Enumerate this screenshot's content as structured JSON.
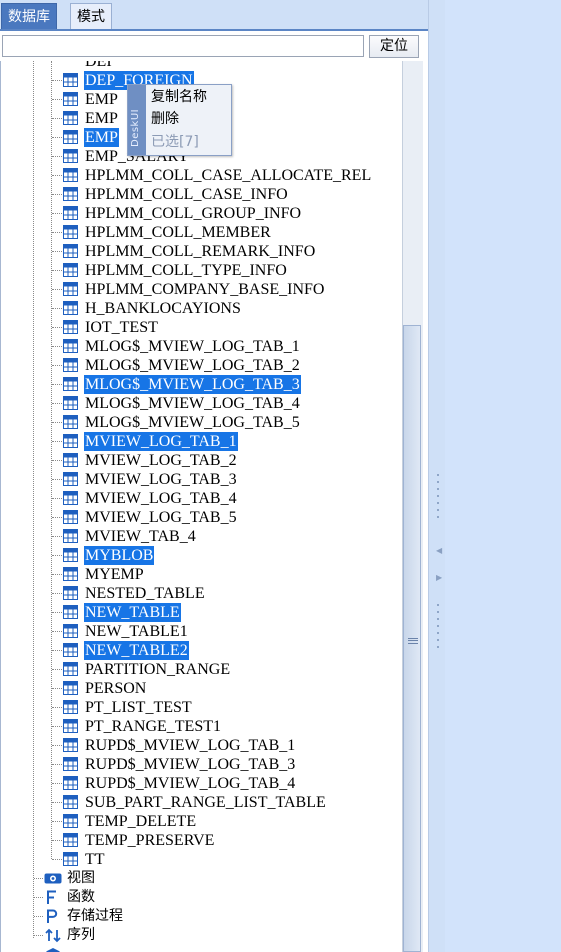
{
  "tabs": [
    {
      "label": "数据库",
      "active": true
    },
    {
      "label": "模式",
      "active": false
    }
  ],
  "search": {
    "value": "",
    "placeholder": "",
    "locate_label": "定位"
  },
  "tables": [
    {
      "name": "DEP_FOREIGN",
      "selected": true
    },
    {
      "name": "EMP",
      "selected": false
    },
    {
      "name": "EMP",
      "selected": false
    },
    {
      "name": "EMP",
      "selected": true
    },
    {
      "name": "EMP_SALARY",
      "selected": false
    },
    {
      "name": "HPLMM_COLL_CASE_ALLOCATE_REL",
      "selected": false
    },
    {
      "name": "HPLMM_COLL_CASE_INFO",
      "selected": false
    },
    {
      "name": "HPLMM_COLL_GROUP_INFO",
      "selected": false
    },
    {
      "name": "HPLMM_COLL_MEMBER",
      "selected": false
    },
    {
      "name": "HPLMM_COLL_REMARK_INFO",
      "selected": false
    },
    {
      "name": "HPLMM_COLL_TYPE_INFO",
      "selected": false
    },
    {
      "name": "HPLMM_COMPANY_BASE_INFO",
      "selected": false
    },
    {
      "name": "H_BANKLOCAYIONS",
      "selected": false
    },
    {
      "name": "IOT_TEST",
      "selected": false
    },
    {
      "name": "MLOG$_MVIEW_LOG_TAB_1",
      "selected": false
    },
    {
      "name": "MLOG$_MVIEW_LOG_TAB_2",
      "selected": false
    },
    {
      "name": "MLOG$_MVIEW_LOG_TAB_3",
      "selected": true
    },
    {
      "name": "MLOG$_MVIEW_LOG_TAB_4",
      "selected": false
    },
    {
      "name": "MLOG$_MVIEW_LOG_TAB_5",
      "selected": false
    },
    {
      "name": "MVIEW_LOG_TAB_1",
      "selected": true
    },
    {
      "name": "MVIEW_LOG_TAB_2",
      "selected": false
    },
    {
      "name": "MVIEW_LOG_TAB_3",
      "selected": false
    },
    {
      "name": "MVIEW_LOG_TAB_4",
      "selected": false
    },
    {
      "name": "MVIEW_LOG_TAB_5",
      "selected": false
    },
    {
      "name": "MVIEW_TAB_4",
      "selected": false
    },
    {
      "name": "MYBLOB",
      "selected": true
    },
    {
      "name": "MYEMP",
      "selected": false
    },
    {
      "name": "NESTED_TABLE",
      "selected": false
    },
    {
      "name": "NEW_TABLE",
      "selected": true
    },
    {
      "name": "NEW_TABLE1",
      "selected": false
    },
    {
      "name": "NEW_TABLE2",
      "selected": true
    },
    {
      "name": "PARTITION_RANGE",
      "selected": false
    },
    {
      "name": "PERSON",
      "selected": false
    },
    {
      "name": "PT_LIST_TEST",
      "selected": false
    },
    {
      "name": "PT_RANGE_TEST1",
      "selected": false
    },
    {
      "name": "RUPD$_MVIEW_LOG_TAB_1",
      "selected": false
    },
    {
      "name": "RUPD$_MVIEW_LOG_TAB_3",
      "selected": false
    },
    {
      "name": "RUPD$_MVIEW_LOG_TAB_4",
      "selected": false
    },
    {
      "name": "SUB_PART_RANGE_LIST_TABLE",
      "selected": false
    },
    {
      "name": "TEMP_DELETE",
      "selected": false
    },
    {
      "name": "TEMP_PRESERVE",
      "selected": false
    },
    {
      "name": "TT",
      "selected": false
    }
  ],
  "categories": [
    {
      "label": "视图",
      "icon": "view-icon"
    },
    {
      "label": "函数",
      "icon": "function-icon"
    },
    {
      "label": "存储过程",
      "icon": "procedure-icon"
    },
    {
      "label": "序列",
      "icon": "sequence-icon"
    }
  ],
  "context_menu": {
    "brand": "DeskUI",
    "items": [
      {
        "label": "复制名称",
        "enabled": true
      },
      {
        "label": "删除",
        "enabled": true
      },
      {
        "label": "已选[7]",
        "enabled": false
      }
    ]
  },
  "colors": {
    "selection": "#1775e6",
    "tab_active": "#4a78bf",
    "panel_bg": "#d2e3fb"
  }
}
